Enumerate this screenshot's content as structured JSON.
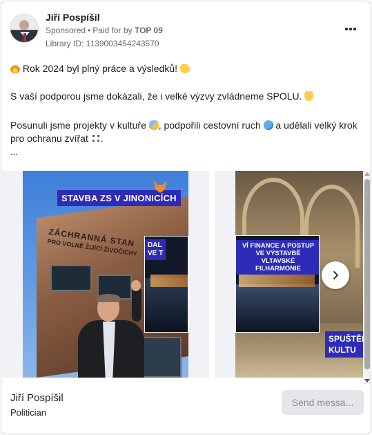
{
  "header": {
    "name": "Jiří Pospíšil",
    "sponsored": "Sponsored",
    "paid_prefix": "Paid for by",
    "paid_by": "TOP 09",
    "library_id": "Library ID: 1139003454243570"
  },
  "body": {
    "line1": "Rok 2024 byl plný práce a výsledků!",
    "line2": "S vaší podporou jsme dokázali, že i velké výzvy zvládneme SPOLU.",
    "line3a": "Posunuli jsme projekty v kultuře",
    "line3b": ", podpořili cestovní ruch",
    "line3c": "a udělali velký krok",
    "line4": "pro ochranu zvířat",
    "line4_end": ".",
    "ellipsis": "..."
  },
  "carousel": {
    "slide1": {
      "label": "STAVBA ZS V JINONICÍCH",
      "sign_line1": "ZÁCHRANNÁ STAN",
      "sign_line2": "PRO VOLNĚ ŽIJÍCÍ ŽIVOČICHY",
      "peek_label": "DAL\nVE T"
    },
    "slide2": {
      "inset_label": "VÍ FINANCE A POSTUP VE VÝSTAVBĚ VLTAVSKÉ FILHARMONIE",
      "label": "SPUŠTĚN\nKULTU"
    }
  },
  "footer": {
    "name": "Jiří Pospíšil",
    "role": "Politician",
    "send_label": "Send messa..."
  },
  "icons": [
    "more-icon",
    "chevron-right-icon",
    "fire-emoji",
    "flexed-biceps-emoji",
    "raised-hands-emoji",
    "performing-arts-emoji",
    "globe-emoji",
    "paw-prints-emoji",
    "fox-emoji"
  ],
  "colors": {
    "label_bg": "#2d2bb8",
    "text": "#1c1e21",
    "muted": "#65676b",
    "button_bg": "#e4e6eb"
  }
}
